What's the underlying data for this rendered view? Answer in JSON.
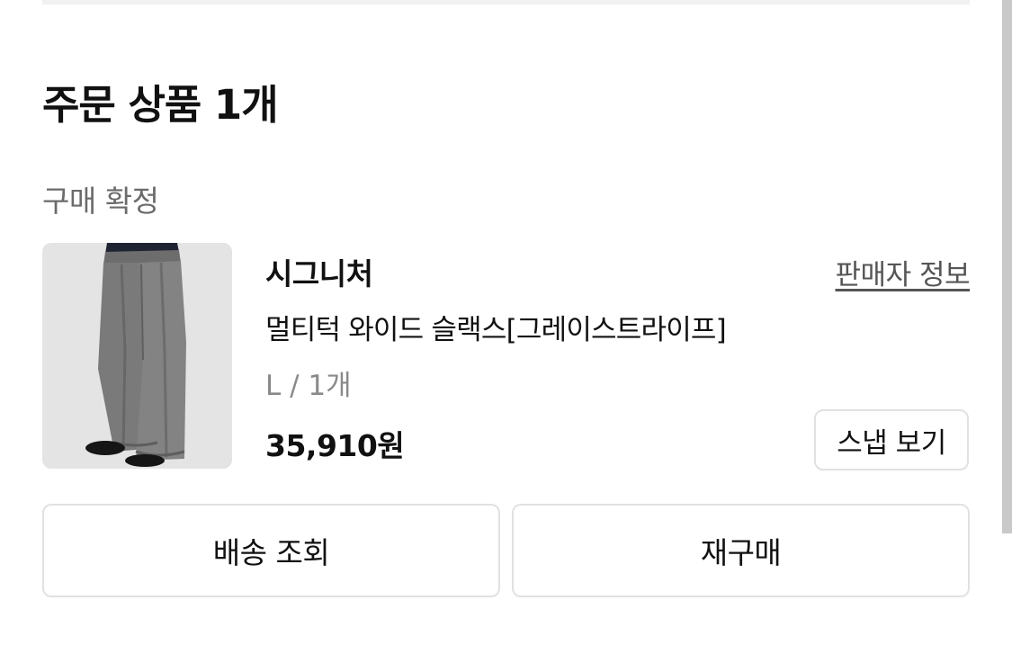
{
  "order_section": {
    "title": "주문 상품 1개"
  },
  "order_item": {
    "status": "구매 확정",
    "brand": "시그니처",
    "seller_info_link": "판매자 정보",
    "product_name": "멀티턱 와이드 슬랙스[그레이스트라이프]",
    "option": "L / 1개",
    "price": "35,910원",
    "snap_button": "스냅 보기",
    "thumbnail_icon": "product-photo-wide-slacks"
  },
  "actions": {
    "track_delivery": "배송 조회",
    "rebuy": "재구매"
  },
  "colors": {
    "text_primary": "#111111",
    "text_secondary": "#6b6b6b",
    "text_muted": "#8a8a8a",
    "border": "#e1e1e1",
    "thumbnail_bg": "#e6e6e6",
    "scrollbar": "#c9c9c9"
  }
}
